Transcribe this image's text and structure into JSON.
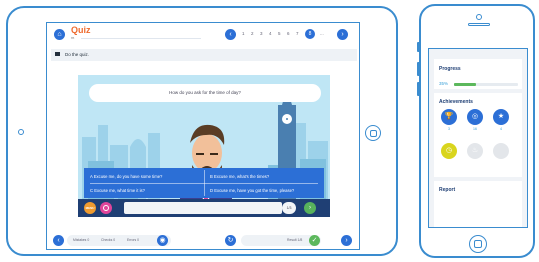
{
  "quiz": {
    "title": "Quiz",
    "subtitle": "85",
    "instruction": "Do the quiz.",
    "pages": [
      "1",
      "2",
      "3",
      "4",
      "5",
      "6",
      "7",
      "..."
    ],
    "current_page": "8",
    "question": "How do you ask for the time of day?",
    "answers": [
      "A  Excuse me, do you have some time?",
      "B  Excuse me, what's the times?",
      "C  Excuse me, what time it is?",
      "D  Excuse me, have you got the time, please?"
    ],
    "menu_label": "MENU",
    "step": "1/3",
    "footer": {
      "mistakes": "Mistakes 0",
      "checks": "Checks 0",
      "errors": "Errors 0",
      "result": "Result 1/8"
    }
  },
  "colors": {
    "accent": "#2c6fd6",
    "brand_orange": "#ef6b2f",
    "device": "#3a8ccf",
    "dark": "#1f3f74",
    "success": "#5cb85c"
  },
  "phone": {
    "progress": {
      "title": "Progress",
      "percent_label": "35%",
      "value": 0.35
    },
    "achievements": {
      "title": "Achievements",
      "badges": [
        {
          "icon": "trophy-icon",
          "color": "#2c6fd6",
          "count": "3"
        },
        {
          "icon": "medal-icon",
          "color": "#2c6fd6",
          "count": "16"
        },
        {
          "icon": "star-icon",
          "color": "#2c6fd6",
          "count": "4"
        },
        {
          "icon": "clock-icon",
          "color": "#d9d51e",
          "count": ""
        },
        {
          "icon": "fire-icon",
          "color": "#e3e6ea",
          "count": ""
        },
        {
          "icon": "locked-badge-icon",
          "color": "#e3e6ea",
          "count": ""
        }
      ]
    },
    "report": {
      "title": "Report"
    }
  }
}
